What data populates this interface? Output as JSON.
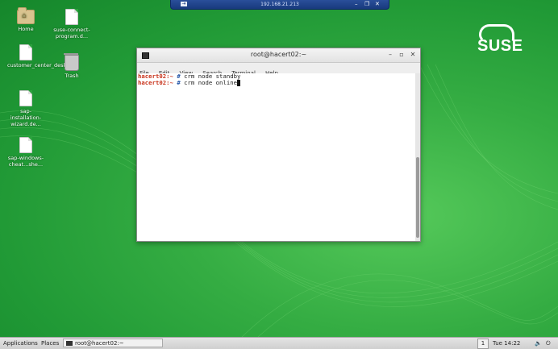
{
  "remote_bar": {
    "address": "192.168.21.213",
    "pin": "⇥",
    "minimize": "–",
    "restore": "❐",
    "close": "✕"
  },
  "desktop_icons": [
    {
      "label": "Home",
      "icon": "home-folder-icon"
    },
    {
      "label": "suse-connect-program.d...",
      "icon": "document-icon"
    },
    {
      "label": "customer_center_desktop",
      "icon": "document-icon"
    },
    {
      "label": "Trash",
      "icon": "trash-icon"
    },
    {
      "label": "sap-installation-wizard.de...",
      "icon": "document-icon"
    },
    {
      "label": "sap-windows-cheat...she...",
      "icon": "document-icon"
    }
  ],
  "logo": {
    "text": "SUSE"
  },
  "terminal": {
    "title": "root@hacert02:~",
    "menu": [
      "File",
      "Edit",
      "View",
      "Search",
      "Terminal",
      "Help"
    ],
    "lines": [
      {
        "host": "hacert02:~",
        "sym": " #",
        "cmd": " crm node standby"
      },
      {
        "host": "hacert02:~",
        "sym": " #",
        "cmd": " crm node online"
      }
    ]
  },
  "taskbar": {
    "applications": "Applications",
    "places": "Places",
    "task": "root@hacert02:~",
    "workspace": "1",
    "clock": "Tue 14:22"
  }
}
